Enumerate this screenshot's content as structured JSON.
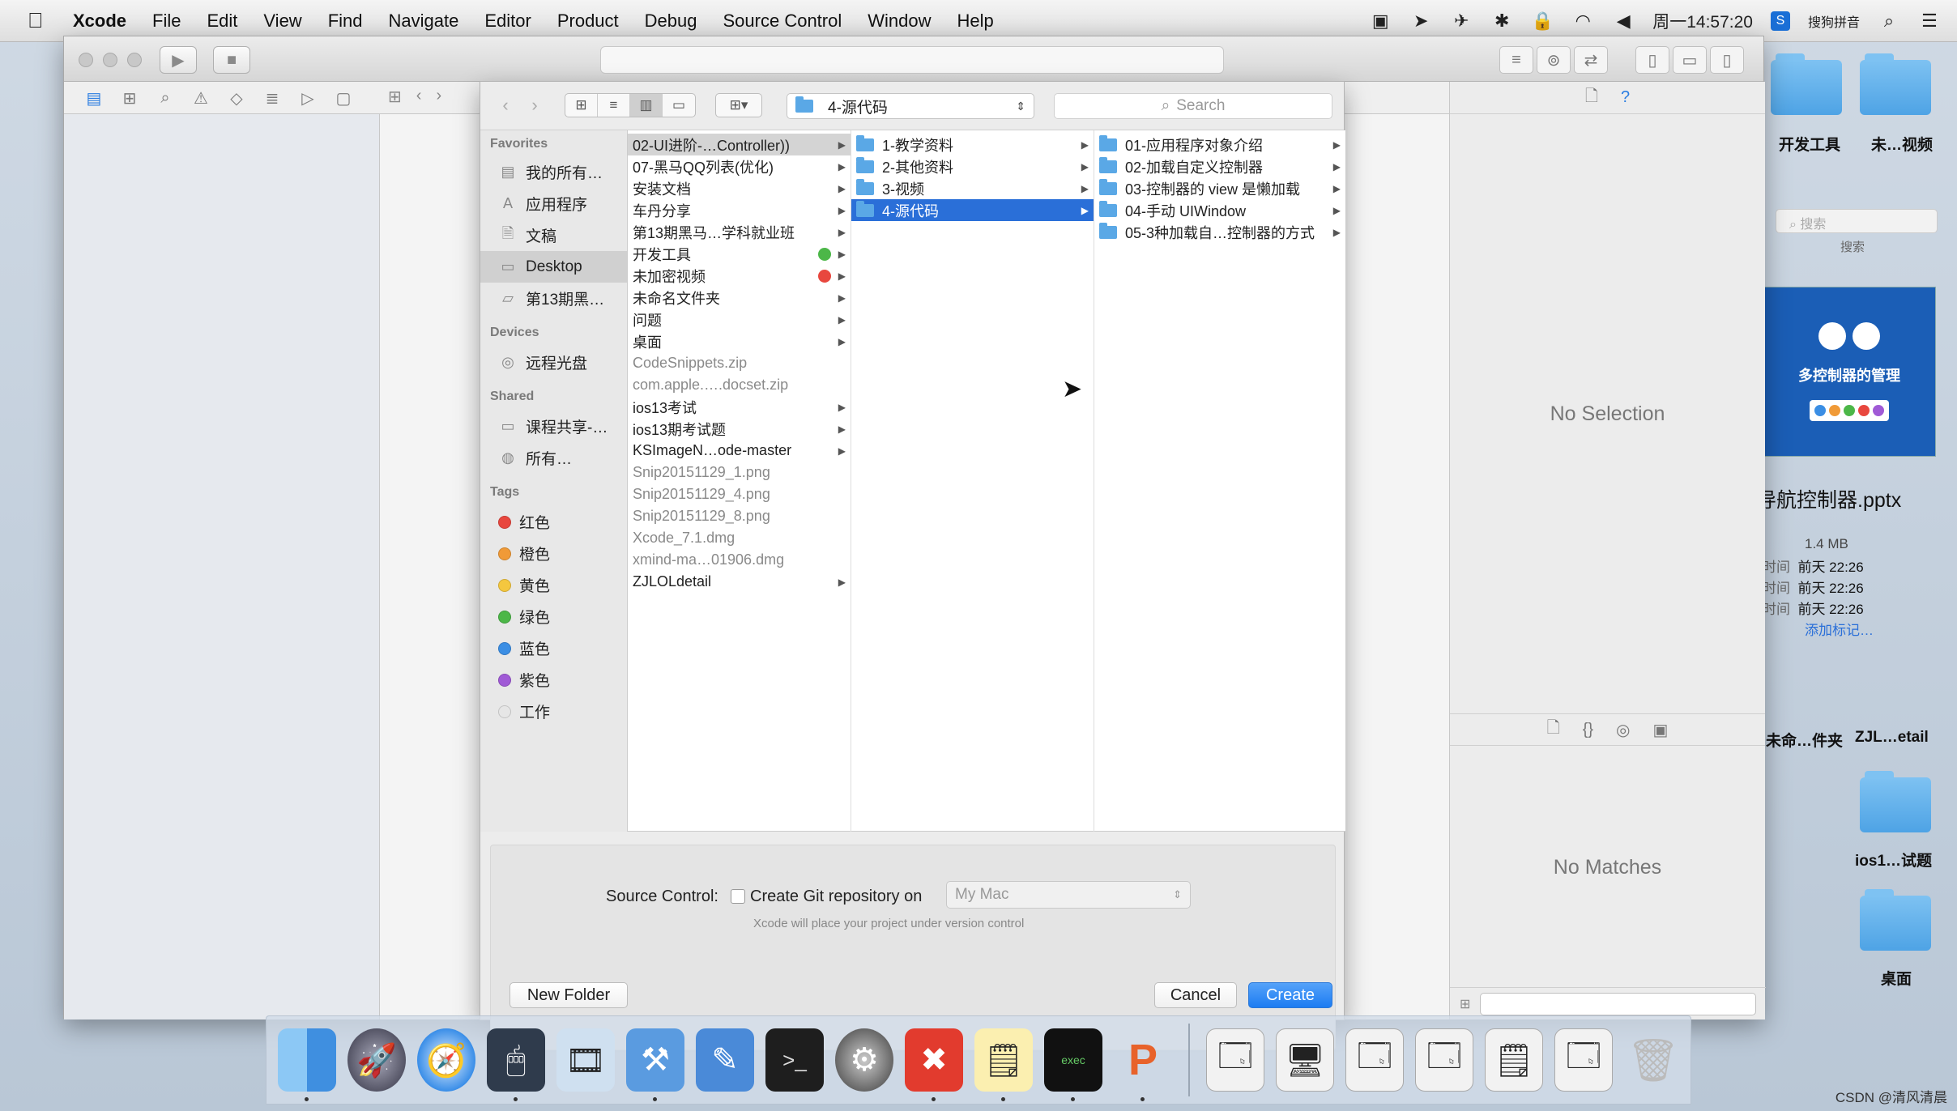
{
  "menubar": {
    "apple": "",
    "app": "Xcode",
    "items": [
      "File",
      "Edit",
      "View",
      "Find",
      "Navigate",
      "Editor",
      "Product",
      "Debug",
      "Source Control",
      "Window",
      "Help"
    ],
    "clock": "周一14:57:20",
    "input_method": "搜狗拼音"
  },
  "xcode": {
    "right_top": "No Selection",
    "right_bottom": "No Matches"
  },
  "sheet": {
    "path": "4-源代码",
    "search_placeholder": "Search",
    "sidebar": {
      "favorites_header": "Favorites",
      "favorites": [
        "我的所有…",
        "应用程序",
        "文稿",
        "Desktop",
        "第13期黑…"
      ],
      "devices_header": "Devices",
      "devices": [
        "远程光盘"
      ],
      "shared_header": "Shared",
      "shared": [
        "课程共享-…",
        "所有…"
      ],
      "tags_header": "Tags",
      "tags": [
        {
          "label": "红色",
          "color": "#e8473e"
        },
        {
          "label": "橙色",
          "color": "#f09a37"
        },
        {
          "label": "黄色",
          "color": "#f4c73f"
        },
        {
          "label": "绿色",
          "color": "#4cb748"
        },
        {
          "label": "蓝色",
          "color": "#3b8ee4"
        },
        {
          "label": "紫色",
          "color": "#a05ad6"
        },
        {
          "label": "工作",
          "color": "#e6e6e6"
        }
      ]
    },
    "col1": [
      {
        "name": "02-UI进阶-…Controller))",
        "folder": true,
        "sel": "gray"
      },
      {
        "name": "07-黑马QQ列表(优化)",
        "folder": true
      },
      {
        "name": "安装文档",
        "folder": true
      },
      {
        "name": "车丹分享",
        "folder": true
      },
      {
        "name": "第13期黑马…学科就业班",
        "folder": true
      },
      {
        "name": "开发工具",
        "folder": true,
        "tag": "#4cb748"
      },
      {
        "name": "未加密视频",
        "folder": true,
        "tag": "#e8473e"
      },
      {
        "name": "未命名文件夹",
        "folder": true
      },
      {
        "name": "问题",
        "folder": true
      },
      {
        "name": "桌面",
        "folder": true
      },
      {
        "name": "CodeSnippets.zip",
        "folder": false
      },
      {
        "name": "com.apple.….docset.zip",
        "folder": false
      },
      {
        "name": "ios13考试",
        "folder": true
      },
      {
        "name": "ios13期考试题",
        "folder": true
      },
      {
        "name": "KSImageN…ode-master",
        "folder": true
      },
      {
        "name": "Snip20151129_1.png",
        "folder": false
      },
      {
        "name": "Snip20151129_4.png",
        "folder": false
      },
      {
        "name": "Snip20151129_8.png",
        "folder": false
      },
      {
        "name": "Xcode_7.1.dmg",
        "folder": false
      },
      {
        "name": "xmind-ma…01906.dmg",
        "folder": false
      },
      {
        "name": "ZJLOLdetail",
        "folder": true
      }
    ],
    "col2": [
      {
        "name": "1-教学资料"
      },
      {
        "name": "2-其他资料"
      },
      {
        "name": "3-视频"
      },
      {
        "name": "4-源代码",
        "sel": "blue"
      }
    ],
    "col3": [
      {
        "name": "01-应用程序对象介绍"
      },
      {
        "name": "02-加载自定义控制器"
      },
      {
        "name": "03-控制器的 view 是懒加载"
      },
      {
        "name": "04-手动 UIWindow"
      },
      {
        "name": "05-3种加载自…控制器的方式"
      }
    ],
    "source_control_label": "Source Control:",
    "git_checkbox_label": "Create Git repository on",
    "git_location": "My Mac",
    "git_hint": "Xcode will place your project under version control",
    "new_folder": "New Folder",
    "cancel": "Cancel",
    "create": "Create"
  },
  "desktop": {
    "icons": [
      "开发工具",
      "未…视频",
      "未命…件夹",
      "ZJL…etail",
      "ios1…试题",
      "桌面"
    ],
    "search_placeholder": "搜索",
    "search_label": "搜索",
    "preview_title": "多控制器的管理",
    "file_name": "导航控制器.pptx",
    "file_size": "1.4 MB",
    "info_rows": [
      {
        "k": "时间",
        "v": "前天 22:26"
      },
      {
        "k": "时间",
        "v": "前天 22:26"
      },
      {
        "k": "时间",
        "v": "前天 22:26"
      }
    ],
    "add_tag": "添加标记…"
  },
  "dock": {
    "apps": [
      "Finder",
      "Launchpad",
      "Safari",
      "Mouse",
      "Photo Slideshow",
      "Xcode",
      "Instruments",
      "Terminal",
      "System Preferences",
      "XMind",
      "Notes",
      "exec",
      "Keynote"
    ],
    "trash": "Trash"
  },
  "watermark": "CSDN @清风清晨"
}
